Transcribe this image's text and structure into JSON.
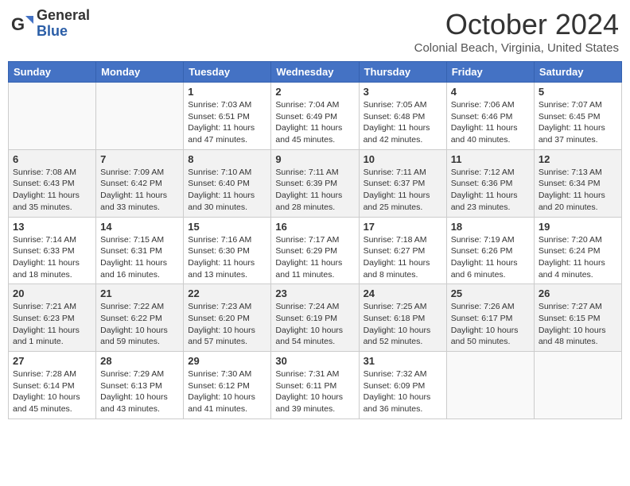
{
  "header": {
    "logo": {
      "general": "General",
      "blue": "Blue"
    },
    "title": "October 2024",
    "subtitle": "Colonial Beach, Virginia, United States"
  },
  "days_of_week": [
    "Sunday",
    "Monday",
    "Tuesday",
    "Wednesday",
    "Thursday",
    "Friday",
    "Saturday"
  ],
  "weeks": [
    [
      {
        "day": "",
        "info": ""
      },
      {
        "day": "",
        "info": ""
      },
      {
        "day": "1",
        "info": "Sunrise: 7:03 AM\nSunset: 6:51 PM\nDaylight: 11 hours and 47 minutes."
      },
      {
        "day": "2",
        "info": "Sunrise: 7:04 AM\nSunset: 6:49 PM\nDaylight: 11 hours and 45 minutes."
      },
      {
        "day": "3",
        "info": "Sunrise: 7:05 AM\nSunset: 6:48 PM\nDaylight: 11 hours and 42 minutes."
      },
      {
        "day": "4",
        "info": "Sunrise: 7:06 AM\nSunset: 6:46 PM\nDaylight: 11 hours and 40 minutes."
      },
      {
        "day": "5",
        "info": "Sunrise: 7:07 AM\nSunset: 6:45 PM\nDaylight: 11 hours and 37 minutes."
      }
    ],
    [
      {
        "day": "6",
        "info": "Sunrise: 7:08 AM\nSunset: 6:43 PM\nDaylight: 11 hours and 35 minutes."
      },
      {
        "day": "7",
        "info": "Sunrise: 7:09 AM\nSunset: 6:42 PM\nDaylight: 11 hours and 33 minutes."
      },
      {
        "day": "8",
        "info": "Sunrise: 7:10 AM\nSunset: 6:40 PM\nDaylight: 11 hours and 30 minutes."
      },
      {
        "day": "9",
        "info": "Sunrise: 7:11 AM\nSunset: 6:39 PM\nDaylight: 11 hours and 28 minutes."
      },
      {
        "day": "10",
        "info": "Sunrise: 7:11 AM\nSunset: 6:37 PM\nDaylight: 11 hours and 25 minutes."
      },
      {
        "day": "11",
        "info": "Sunrise: 7:12 AM\nSunset: 6:36 PM\nDaylight: 11 hours and 23 minutes."
      },
      {
        "day": "12",
        "info": "Sunrise: 7:13 AM\nSunset: 6:34 PM\nDaylight: 11 hours and 20 minutes."
      }
    ],
    [
      {
        "day": "13",
        "info": "Sunrise: 7:14 AM\nSunset: 6:33 PM\nDaylight: 11 hours and 18 minutes."
      },
      {
        "day": "14",
        "info": "Sunrise: 7:15 AM\nSunset: 6:31 PM\nDaylight: 11 hours and 16 minutes."
      },
      {
        "day": "15",
        "info": "Sunrise: 7:16 AM\nSunset: 6:30 PM\nDaylight: 11 hours and 13 minutes."
      },
      {
        "day": "16",
        "info": "Sunrise: 7:17 AM\nSunset: 6:29 PM\nDaylight: 11 hours and 11 minutes."
      },
      {
        "day": "17",
        "info": "Sunrise: 7:18 AM\nSunset: 6:27 PM\nDaylight: 11 hours and 8 minutes."
      },
      {
        "day": "18",
        "info": "Sunrise: 7:19 AM\nSunset: 6:26 PM\nDaylight: 11 hours and 6 minutes."
      },
      {
        "day": "19",
        "info": "Sunrise: 7:20 AM\nSunset: 6:24 PM\nDaylight: 11 hours and 4 minutes."
      }
    ],
    [
      {
        "day": "20",
        "info": "Sunrise: 7:21 AM\nSunset: 6:23 PM\nDaylight: 11 hours and 1 minute."
      },
      {
        "day": "21",
        "info": "Sunrise: 7:22 AM\nSunset: 6:22 PM\nDaylight: 10 hours and 59 minutes."
      },
      {
        "day": "22",
        "info": "Sunrise: 7:23 AM\nSunset: 6:20 PM\nDaylight: 10 hours and 57 minutes."
      },
      {
        "day": "23",
        "info": "Sunrise: 7:24 AM\nSunset: 6:19 PM\nDaylight: 10 hours and 54 minutes."
      },
      {
        "day": "24",
        "info": "Sunrise: 7:25 AM\nSunset: 6:18 PM\nDaylight: 10 hours and 52 minutes."
      },
      {
        "day": "25",
        "info": "Sunrise: 7:26 AM\nSunset: 6:17 PM\nDaylight: 10 hours and 50 minutes."
      },
      {
        "day": "26",
        "info": "Sunrise: 7:27 AM\nSunset: 6:15 PM\nDaylight: 10 hours and 48 minutes."
      }
    ],
    [
      {
        "day": "27",
        "info": "Sunrise: 7:28 AM\nSunset: 6:14 PM\nDaylight: 10 hours and 45 minutes."
      },
      {
        "day": "28",
        "info": "Sunrise: 7:29 AM\nSunset: 6:13 PM\nDaylight: 10 hours and 43 minutes."
      },
      {
        "day": "29",
        "info": "Sunrise: 7:30 AM\nSunset: 6:12 PM\nDaylight: 10 hours and 41 minutes."
      },
      {
        "day": "30",
        "info": "Sunrise: 7:31 AM\nSunset: 6:11 PM\nDaylight: 10 hours and 39 minutes."
      },
      {
        "day": "31",
        "info": "Sunrise: 7:32 AM\nSunset: 6:09 PM\nDaylight: 10 hours and 36 minutes."
      },
      {
        "day": "",
        "info": ""
      },
      {
        "day": "",
        "info": ""
      }
    ]
  ]
}
